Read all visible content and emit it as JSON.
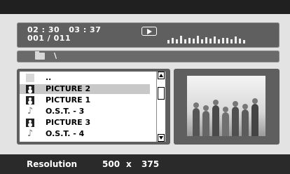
{
  "info": {
    "elapsed_time": "02 : 30",
    "total_time": "03 : 37",
    "track_counter": "001 / 011",
    "play_state": "play-icon",
    "equalizer_levels": [
      0.35,
      0.55,
      0.45,
      0.75,
      0.4,
      0.6,
      0.5,
      0.8,
      0.45,
      0.65,
      0.5,
      0.7,
      0.4,
      0.6,
      0.55,
      0.45,
      0.7,
      0.5,
      0.35
    ]
  },
  "path": {
    "folder_icon": "folder-icon",
    "current_path": "\\"
  },
  "file_list": {
    "items": [
      {
        "icon": "parent-folder-icon",
        "label": "..",
        "selected": false
      },
      {
        "icon": "picture-icon",
        "label": "PICTURE 2",
        "selected": true
      },
      {
        "icon": "picture-icon",
        "label": "PICTURE 1",
        "selected": false
      },
      {
        "icon": "music-note-icon",
        "label": "O.S.T. - 3",
        "selected": false
      },
      {
        "icon": "picture-icon",
        "label": "PICTURE 3",
        "selected": false
      },
      {
        "icon": "music-note-icon",
        "label": "O.S.T. - 4",
        "selected": false
      }
    ]
  },
  "preview": {
    "image": "photo-preview"
  },
  "status": {
    "resolution_label": "Resolution",
    "width": "500",
    "separator": "x",
    "height": "375"
  }
}
